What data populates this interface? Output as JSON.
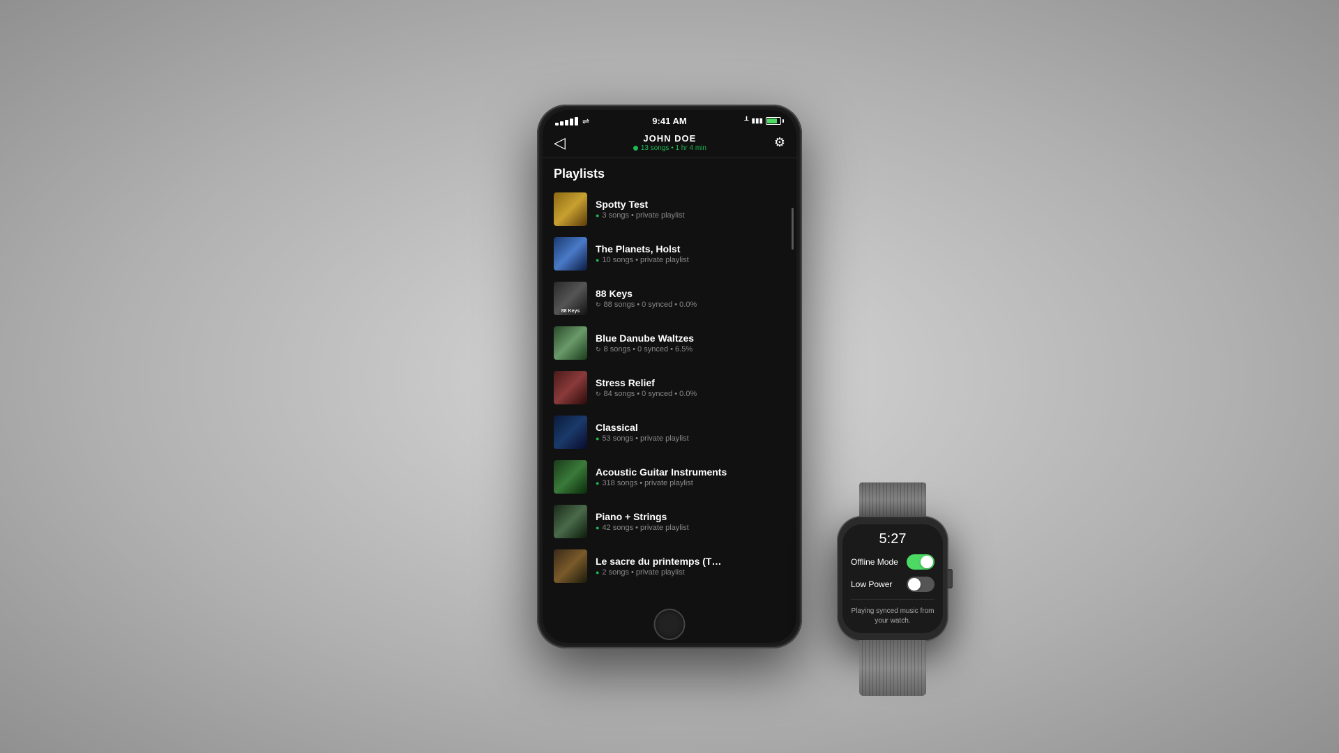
{
  "scene": {
    "background": "radial-gradient(ellipse at center, #d8d8d8 0%, #b0b0b0 60%, #909090 100%)"
  },
  "phone": {
    "status": {
      "time": "9:41 AM",
      "signal_dots": [
        3,
        4,
        5,
        6,
        7
      ],
      "wifi": "wifi"
    },
    "header": {
      "back_icon": "◁",
      "title": "JOHN DOE",
      "subtitle": "13 songs • 1 hr 4 min",
      "settings_icon": "⚙"
    },
    "playlists_label": "Playlists",
    "playlists": [
      {
        "name": "Spotty Test",
        "meta": "3 songs • private playlist",
        "meta_icon": "green_circle",
        "thumb_class": "thumb-spotty",
        "thumb_label": ""
      },
      {
        "name": "The Planets, Holst",
        "meta": "10 songs • private playlist",
        "meta_icon": "green_circle",
        "thumb_class": "thumb-planets",
        "thumb_label": ""
      },
      {
        "name": "88 Keys",
        "meta": "88 songs • 0 synced • 0.0%",
        "meta_icon": "sync_gray",
        "thumb_class": "thumb-88keys",
        "thumb_label": "88 Keys"
      },
      {
        "name": "Blue Danube Waltzes",
        "meta": "8 songs • 0 synced • 6.5%",
        "meta_icon": "sync_gray",
        "thumb_class": "thumb-danube",
        "thumb_label": ""
      },
      {
        "name": "Stress Relief",
        "meta": "84 songs • 0 synced • 0.0%",
        "meta_icon": "sync_gray",
        "thumb_class": "thumb-stress",
        "thumb_label": ""
      },
      {
        "name": "Classical",
        "meta": "53 songs • private playlist",
        "meta_icon": "green_circle",
        "thumb_class": "thumb-classical",
        "thumb_label": ""
      },
      {
        "name": "Acoustic Guitar Instruments",
        "meta": "318 songs • private playlist",
        "meta_icon": "green_circle",
        "thumb_class": "thumb-acoustic",
        "thumb_label": ""
      },
      {
        "name": "Piano + Strings",
        "meta": "42 songs • private playlist",
        "meta_icon": "green_circle",
        "thumb_class": "thumb-piano",
        "thumb_label": ""
      },
      {
        "name": "Le sacre du printemps (T…",
        "meta": "2 songs • private playlist",
        "meta_icon": "green_circle",
        "thumb_class": "thumb-sacre",
        "thumb_label": ""
      }
    ]
  },
  "watch": {
    "time": "5:27",
    "offline_mode_label": "Offline Mode",
    "offline_mode_on": true,
    "low_power_label": "Low Power",
    "low_power_on": false,
    "body_text": "Playing synced music from your watch."
  }
}
